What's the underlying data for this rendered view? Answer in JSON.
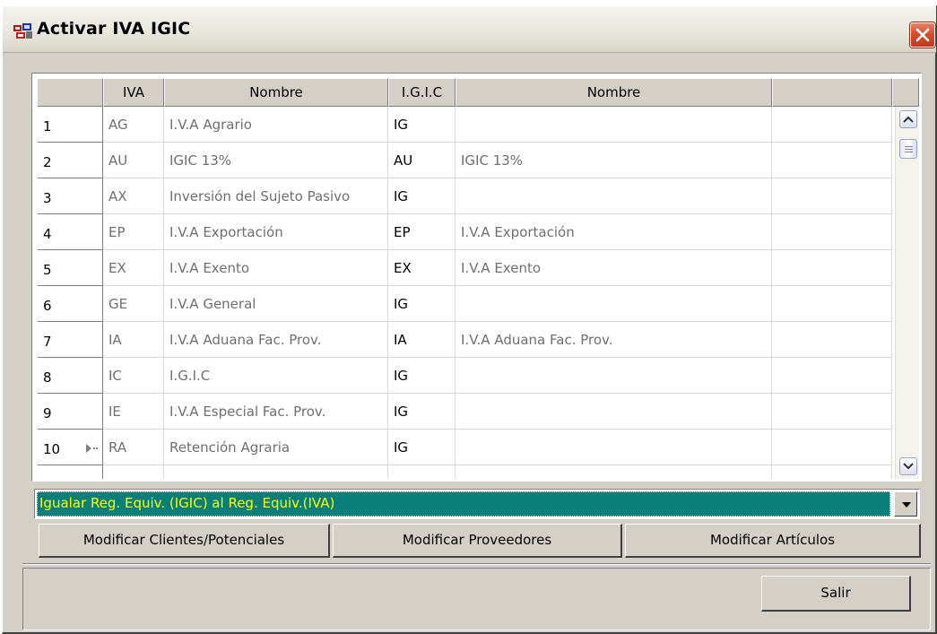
{
  "window": {
    "title": "Activar IVA IGIC"
  },
  "grid": {
    "columns": [
      "IVA",
      "Nombre",
      "I.G.I.C",
      "Nombre",
      ""
    ],
    "rows": [
      {
        "num": "1",
        "iva": "AG",
        "nombre": "I.V.A Agrario",
        "igic": "IG",
        "nombre2": ""
      },
      {
        "num": "2",
        "iva": "AU",
        "nombre": "IGIC 13%",
        "igic": "AU",
        "nombre2": "IGIC 13%"
      },
      {
        "num": "3",
        "iva": "AX",
        "nombre": "Inversión del Sujeto Pasivo",
        "igic": "IG",
        "nombre2": ""
      },
      {
        "num": "4",
        "iva": "EP",
        "nombre": "I.V.A Exportación",
        "igic": "EP",
        "nombre2": "I.V.A Exportación"
      },
      {
        "num": "5",
        "iva": "EX",
        "nombre": "I.V.A Exento",
        "igic": "EX",
        "nombre2": "I.V.A Exento"
      },
      {
        "num": "6",
        "iva": "GE",
        "nombre": "I.V.A General",
        "igic": "IG",
        "nombre2": ""
      },
      {
        "num": "7",
        "iva": "IA",
        "nombre": "I.V.A Aduana Fac. Prov.",
        "igic": "IA",
        "nombre2": "I.V.A Aduana Fac. Prov."
      },
      {
        "num": "8",
        "iva": "IC",
        "nombre": "I.G.I.C",
        "igic": "IG",
        "nombre2": ""
      },
      {
        "num": "9",
        "iva": "IE",
        "nombre": "I.V.A Especial Fac. Prov.",
        "igic": "IG",
        "nombre2": ""
      },
      {
        "num": "10",
        "iva": "RA",
        "nombre": "Retención Agraria",
        "igic": "IG",
        "nombre2": ""
      }
    ]
  },
  "combo": {
    "selected": "Igualar Reg. Equiv. (IGIC) al Reg. Equiv.(IVA)"
  },
  "buttons": {
    "clientes": "Modificar Clientes/Potenciales",
    "proveedores": "Modificar Proveedores",
    "articulos": "Modificar Artículos",
    "salir": "Salir"
  },
  "colors": {
    "combo_bg": "#0a7f7a",
    "combo_text": "#ffff00",
    "window_bg": "#d4d0c8"
  },
  "icons": {
    "app": "app-icon",
    "close": "close-icon",
    "scroll_up": "scroll-up-icon",
    "scroll_down": "scroll-down-icon",
    "dropdown": "dropdown-arrow-icon",
    "row_pointer": "row-pointer-icon"
  }
}
